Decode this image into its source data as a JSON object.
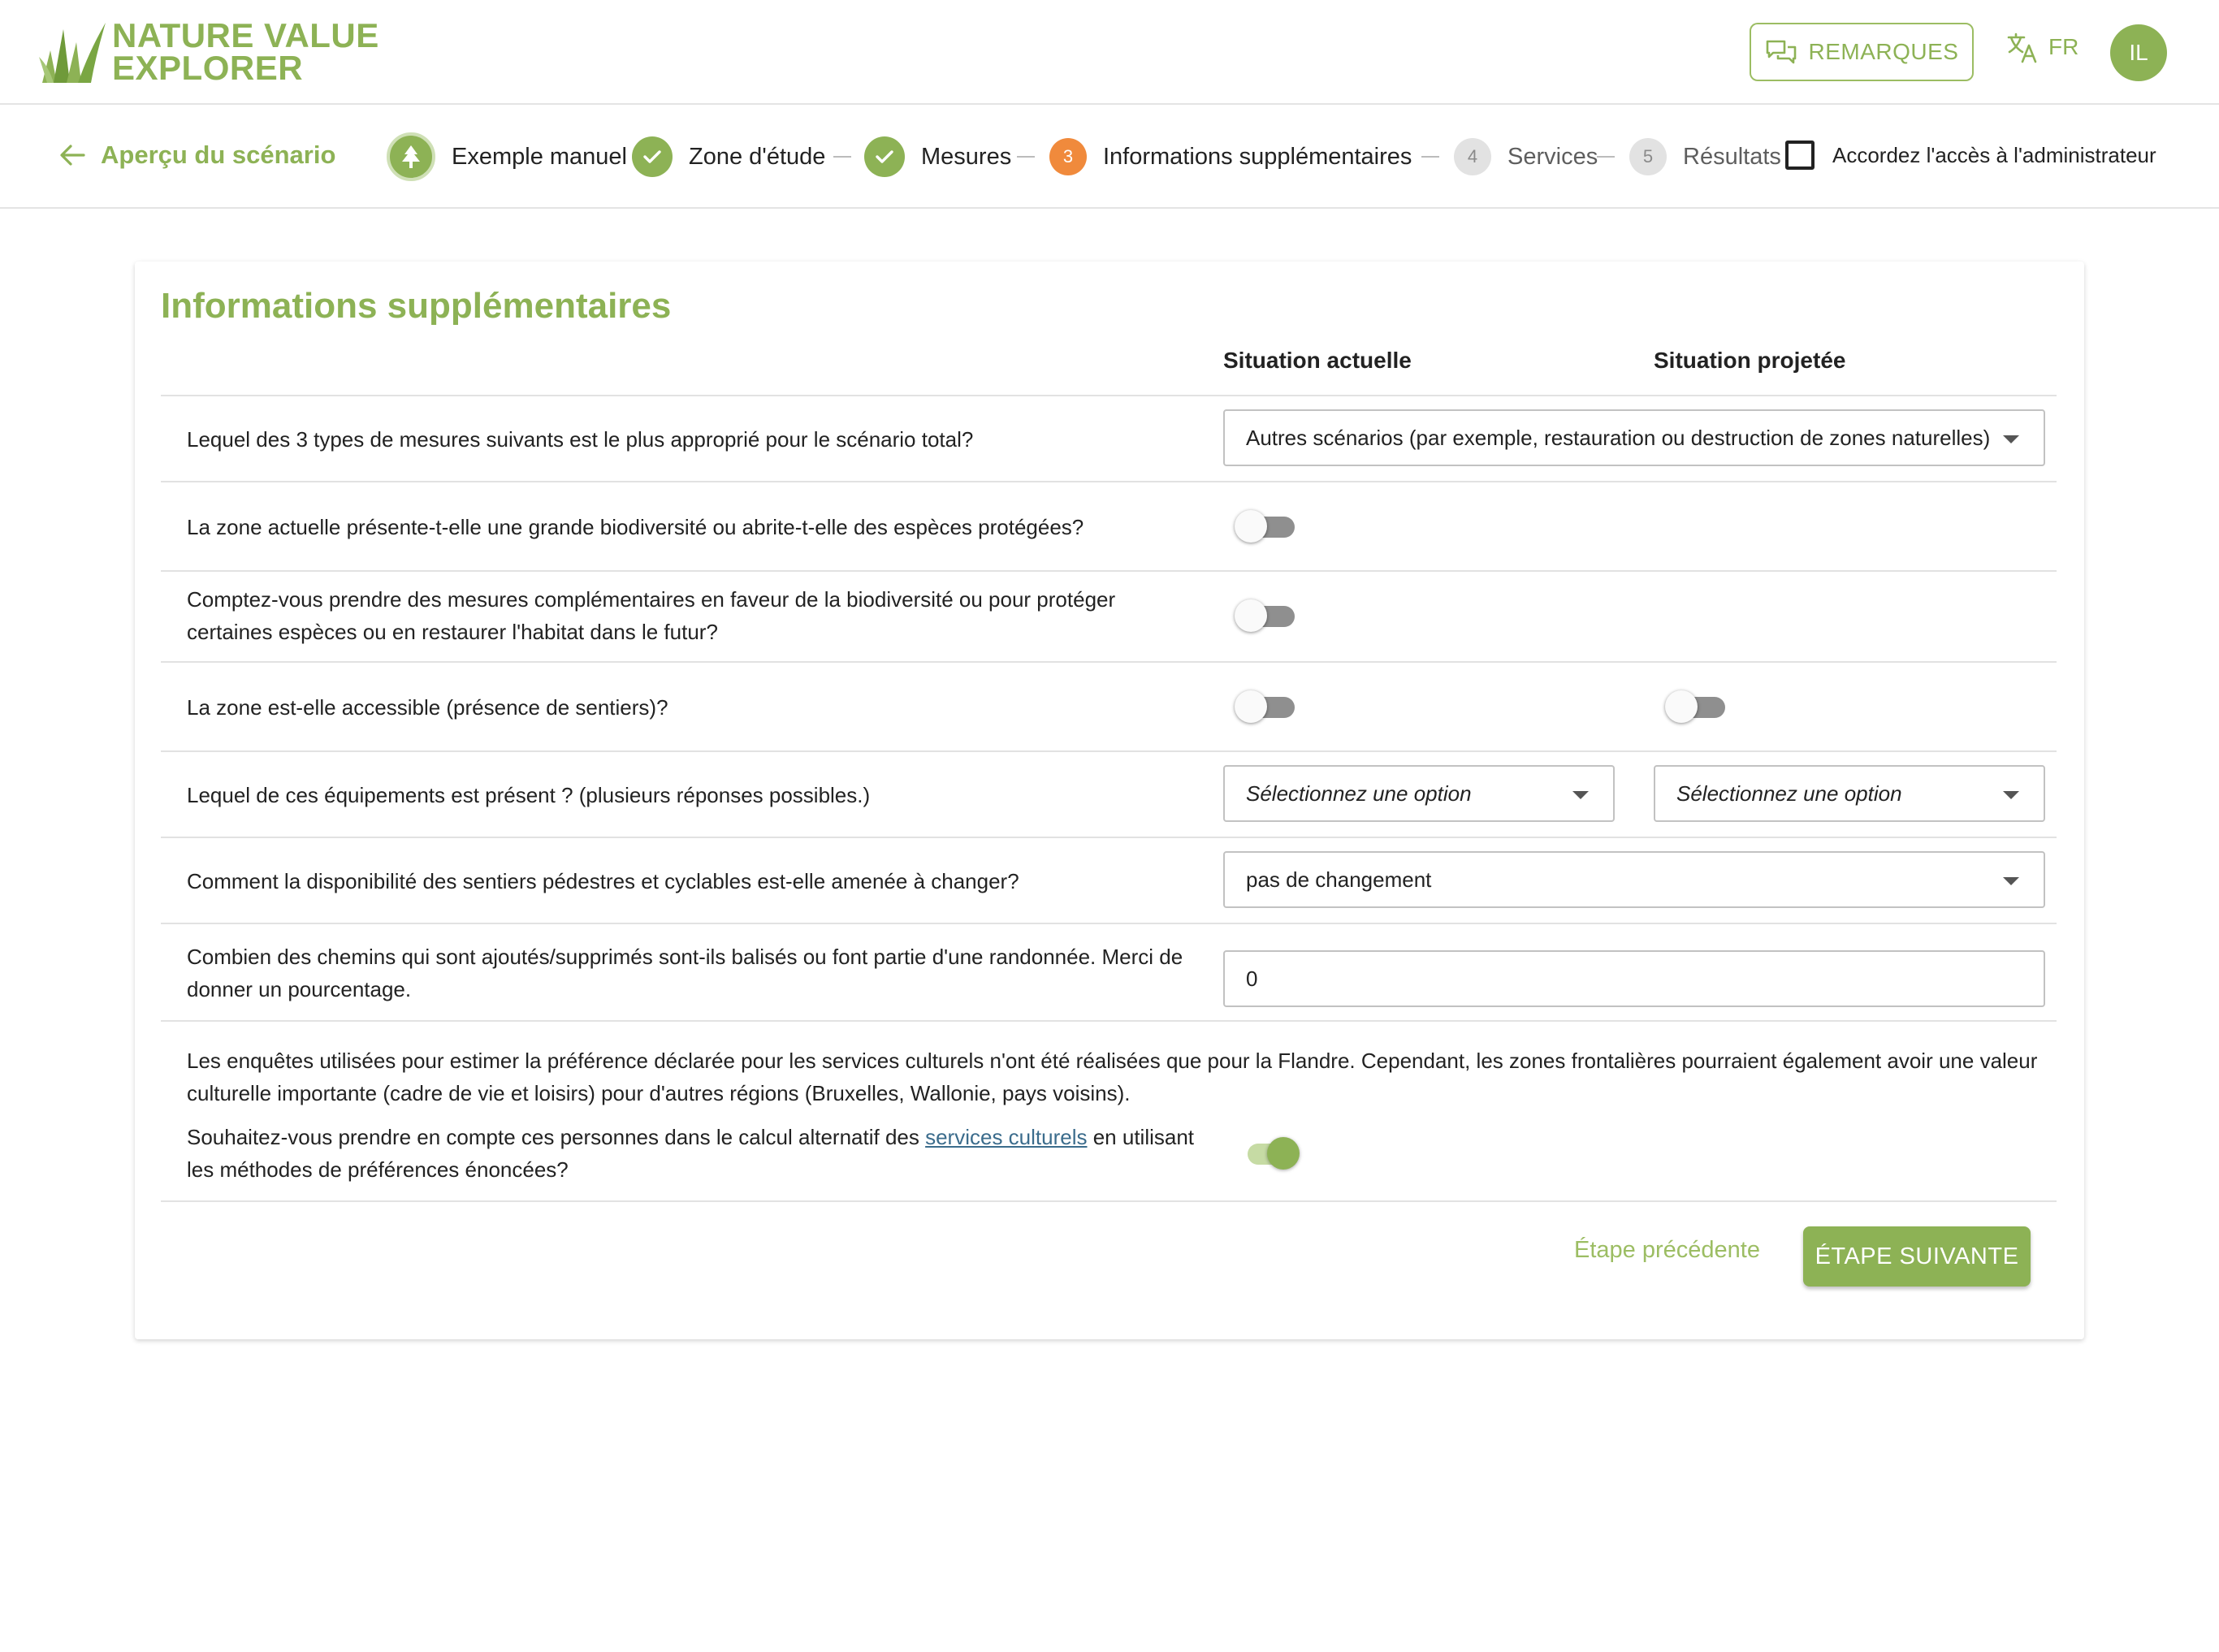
{
  "header": {
    "logo_line1": "NATURE VALUE",
    "logo_line2": "EXPLORER",
    "feedback_label": "REMARQUES",
    "language": "FR",
    "avatar_initials": "IL"
  },
  "stepper": {
    "back_label": "Aperçu du scénario",
    "scenario_name": "Exemple manuel",
    "steps": [
      {
        "label": "Zone d'étude",
        "state": "done"
      },
      {
        "label": "Mesures",
        "state": "done"
      },
      {
        "number": "3",
        "label": "Informations supplémentaires",
        "state": "active"
      },
      {
        "number": "4",
        "label": "Services",
        "state": "todo"
      },
      {
        "number": "5",
        "label": "Résultats",
        "state": "todo"
      }
    ],
    "admin_access_label": "Accordez l'accès à l'administrateur",
    "admin_access_checked": false
  },
  "form": {
    "title": "Informations supplémentaires",
    "col_current": "Situation actuelle",
    "col_projected": "Situation projetée",
    "q1": {
      "text": "Lequel des 3 types de mesures suivants est le plus approprié pour le scénario total?",
      "value": "Autres scénarios (par exemple, restauration ou destruction de zones naturelles)"
    },
    "q2": {
      "text": "La zone actuelle présente-t-elle une grande biodiversité ou abrite-t-elle des espèces protégées?",
      "current": false
    },
    "q3": {
      "line1": "Comptez-vous prendre des mesures complémentaires en faveur de la biodiversité ou pour protéger",
      "line2": "certaines espèces ou en restaurer l'habitat dans le futur?",
      "current": false
    },
    "q4": {
      "text": "La zone est-elle accessible (présence de sentiers)?",
      "current": false,
      "projected": false
    },
    "q5": {
      "text": "Lequel de ces équipements est présent ? (plusieurs réponses possibles.)",
      "current_placeholder": "Sélectionnez une option",
      "projected_placeholder": "Sélectionnez une option"
    },
    "q6": {
      "text": "Comment la disponibilité des sentiers pédestres et cyclables est-elle amenée à changer?",
      "value": "pas de changement"
    },
    "q7": {
      "line1": "Combien des chemins qui sont ajoutés/supprimés sont-ils balisés ou font partie d'une randonnée. Merci de",
      "line2": "donner un pourcentage.",
      "value": "0"
    },
    "info": {
      "line1": "Les enquêtes utilisées pour estimer la préférence déclarée pour les services culturels n'ont été réalisées que pour la Flandre. Cependant, les zones frontalières pourraient également avoir une valeur",
      "line2": "culturelle importante (cadre de vie et loisirs) pour d'autres régions (Bruxelles, Wallonie, pays voisins).",
      "q_before_link": "Souhaitez-vous prendre en compte ces personnes dans le calcul alternatif des ",
      "q_link": "services culturels",
      "q_after_link": " en utilisant",
      "q_line2": "les méthodes de préférences énoncées?",
      "enabled": true
    },
    "prev_label": "Étape précédente",
    "next_label": "ÉTAPE SUIVANTE"
  },
  "colors": {
    "brand_green": "#8db255",
    "active_step_orange": "#f08a3c"
  }
}
